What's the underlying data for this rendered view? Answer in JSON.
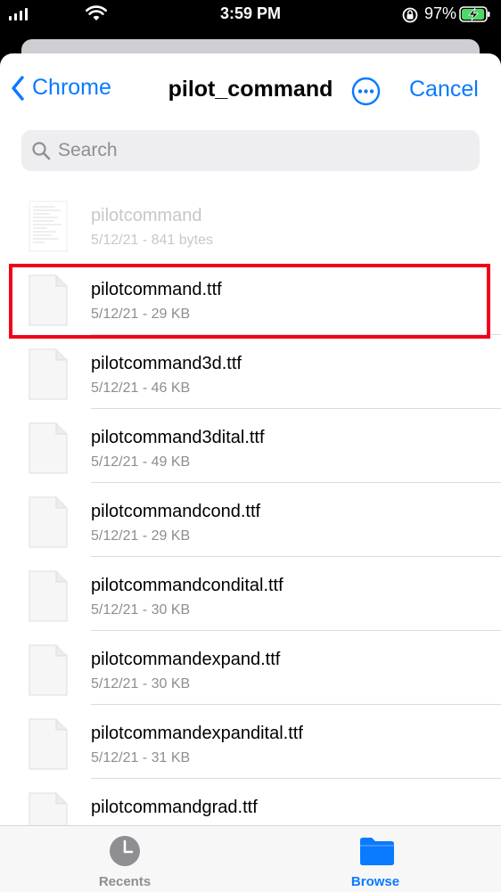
{
  "status_bar": {
    "time": "3:59 PM",
    "battery_percent": "97%",
    "icons": [
      "signal-bars-icon",
      "wifi-icon",
      "orientation-lock-icon",
      "battery-charging-icon"
    ],
    "battery_level": 0.97
  },
  "nav": {
    "back_label": "Chrome",
    "title": "pilot_command",
    "cancel_label": "Cancel",
    "more_icon": "ellipsis-circle-icon",
    "back_icon": "chevron-left-icon"
  },
  "search": {
    "placeholder": "Search",
    "value": "",
    "icon": "magnifier-icon"
  },
  "files": [
    {
      "name": "pilotcommand",
      "meta": "5/12/21 - 841 bytes",
      "disabled": true,
      "thumb": "text-document-icon"
    },
    {
      "name": "pilotcommand.ttf",
      "meta": "5/12/21 - 29 KB",
      "highlighted": true,
      "thumb": "blank-document-icon"
    },
    {
      "name": "pilotcommand3d.ttf",
      "meta": "5/12/21 - 46 KB",
      "thumb": "blank-document-icon"
    },
    {
      "name": "pilotcommand3dital.ttf",
      "meta": "5/12/21 - 49 KB",
      "thumb": "blank-document-icon"
    },
    {
      "name": "pilotcommandcond.ttf",
      "meta": "5/12/21 - 29 KB",
      "thumb": "blank-document-icon"
    },
    {
      "name": "pilotcommandcondital.ttf",
      "meta": "5/12/21 - 30 KB",
      "thumb": "blank-document-icon"
    },
    {
      "name": "pilotcommandexpand.ttf",
      "meta": "5/12/21 - 30 KB",
      "thumb": "blank-document-icon"
    },
    {
      "name": "pilotcommandexpandital.ttf",
      "meta": "5/12/21 - 31 KB",
      "thumb": "blank-document-icon"
    },
    {
      "name": "pilotcommandgrad.ttf",
      "meta": "",
      "thumb": "blank-document-icon"
    }
  ],
  "tab_bar": {
    "tabs": [
      {
        "label": "Recents",
        "icon": "clock-icon",
        "active": false
      },
      {
        "label": "Browse",
        "icon": "folder-icon",
        "active": true
      }
    ]
  },
  "colors": {
    "accent": "#0a7aff",
    "highlight_border": "#f2001b",
    "secondary_text": "#8e8e93"
  }
}
